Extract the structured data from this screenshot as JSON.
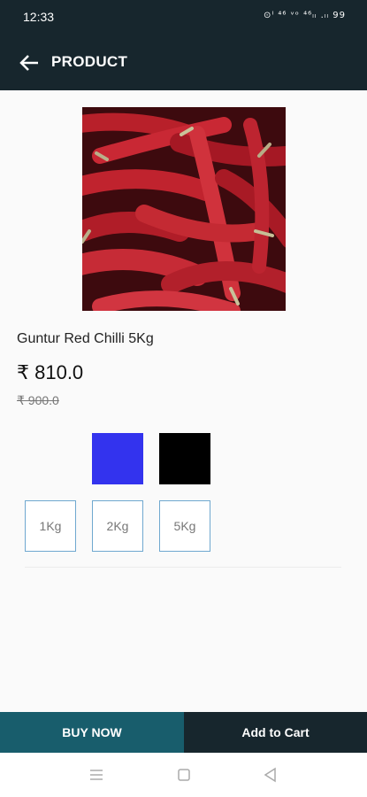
{
  "status_bar": {
    "time": "12:33",
    "icons_text": "⊙ᴵ ⁴⁶ ᵛᵒ ⁴⁶ₗₗ .ₗₗ 99"
  },
  "app_bar": {
    "back_icon": "arrow-left-icon",
    "title": "PRODUCT"
  },
  "product": {
    "image_subject": "dried red chillies",
    "name": "Guntur Red Chilli 5Kg",
    "price": "₹ 810.0",
    "old_price": "₹ 900.0"
  },
  "colors": {
    "swatches": [
      "#3333ee",
      "#000000"
    ],
    "app_bar": "#17262d",
    "buy_now": "#185d6c",
    "size_border": "#6fa8cf"
  },
  "sizes": [
    "1Kg",
    "2Kg",
    "5Kg"
  ],
  "actions": {
    "buy_now": "BUY NOW",
    "add_to_cart": "Add to Cart"
  },
  "nav_bar": {
    "icons": [
      "menu-icon",
      "home-square-icon",
      "back-triangle-icon"
    ]
  }
}
